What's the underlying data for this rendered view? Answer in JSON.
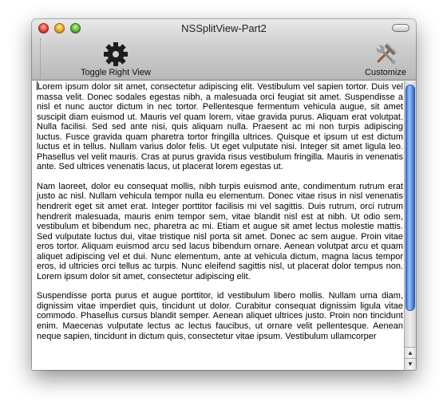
{
  "window": {
    "title": "NSSplitView-Part2"
  },
  "toolbar": {
    "toggle_label": "Toggle Right View",
    "customize_label": "Customize"
  },
  "text": {
    "p1": "Lorem ipsum dolor sit amet, consectetur adipiscing elit. Vestibulum vel sapien tortor. Duis vel massa velit. Donec sodales egestas nibh, a malesuada orci feugiat sit amet. Suspendisse a nisl et nunc auctor dictum in nec tortor. Pellentesque fermentum vehicula augue, sit amet suscipit diam euismod ut. Mauris vel quam lorem, vitae gravida purus. Aliquam erat volutpat. Nulla facilisi. Sed sed ante nisi, quis aliquam nulla. Praesent ac mi non turpis adipiscing luctus. Fusce gravida quam pharetra tortor fringilla ultrices. Quisque et ipsum ut est dictum luctus et in tellus. Nullam varius dolor felis. Ut eget vulputate nisi. Integer sit amet ligula leo. Phasellus vel velit mauris. Cras at purus gravida risus vestibulum fringilla. Mauris in venenatis ante. Sed ultrices venenatis lacus, ut placerat lorem egestas ut.",
    "p2": "Nam laoreet, dolor eu consequat mollis, nibh turpis euismod ante, condimentum rutrum erat justo ac nisl. Nullam vehicula tempor nulla eu elementum. Donec vitae risus in nisl venenatis hendrerit eget sit amet erat. Integer porttitor facilisis mi vel sagittis. Duis rutrum, orci rutrum hendrerit malesuada, mauris enim tempor sem, vitae blandit nisl est at nibh. Ut odio sem, vestibulum et bibendum nec, pharetra ac mi. Etiam et augue sit amet lectus molestie mattis. Sed vulputate luctus dui, vitae tristique nisl porta sit amet. Donec ac sem augue. Proin vitae eros tortor. Aliquam euismod arcu sed lacus bibendum ornare. Aenean volutpat arcu et quam aliquet adipiscing vel et dui. Nunc elementum, ante at vehicula dictum, magna lacus tempor eros, id ultricies orci tellus ac turpis. Nunc eleifend sagittis nisl, ut placerat dolor tempus non. Lorem ipsum dolor sit amet, consectetur adipiscing elit.",
    "p3": "Suspendisse porta purus et augue porttitor, id vestibulum libero mollis. Nullam urna diam, dignissim vitae imperdiet quis, tincidunt ut dolor. Curabitur consequat dignissim ligula vitae commodo. Phasellus cursus blandit semper. Aenean aliquet ultrices justo. Proin non tincidunt enim. Maecenas vulputate lectus ac lectus faucibus, ut ornare velit pellentesque. Aenean neque sapien, tincidunt in dictum quis, consectetur vitae ipsum. Vestibulum ullamcorper"
  },
  "scroll": {
    "position_fraction": 0.0,
    "visible_fraction": 0.82
  },
  "icons": {
    "toggle": "gear-icon",
    "customize": "hammer-wrench-icon"
  }
}
